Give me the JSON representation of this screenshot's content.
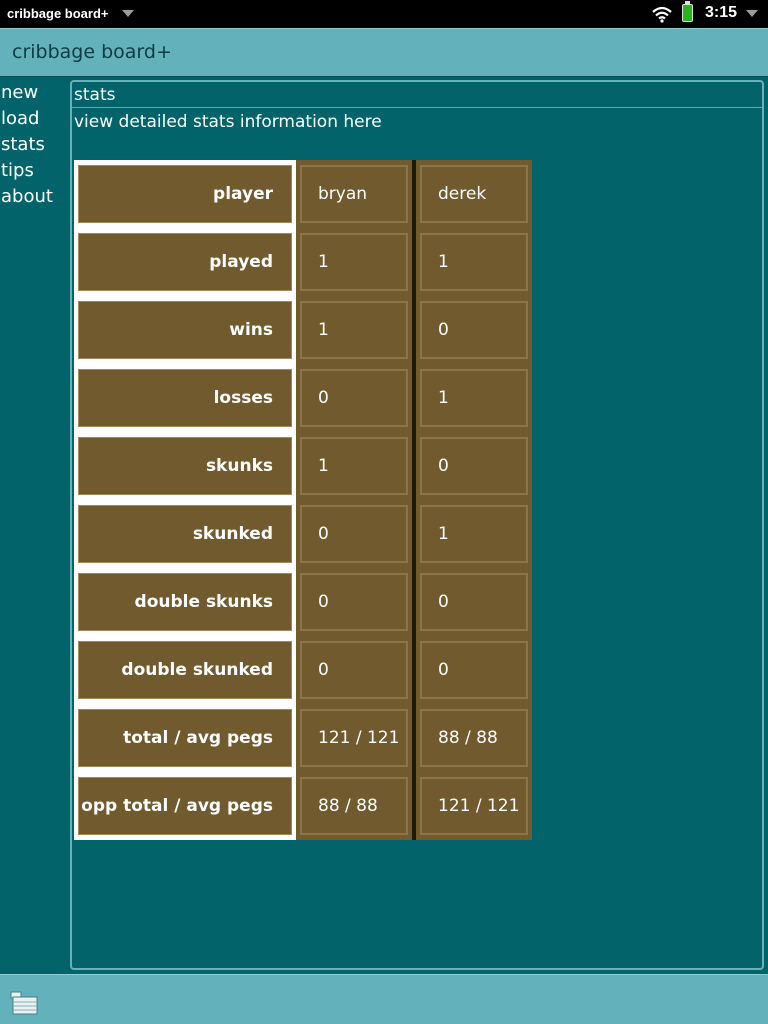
{
  "status_bar": {
    "app_name": "cribbage board+",
    "time": "3:15",
    "icons": [
      "chevron-down-icon",
      "wifi-icon",
      "battery-icon",
      "chevron-down-icon"
    ],
    "battery_color": "#29b41e"
  },
  "header": {
    "title": "cribbage board+"
  },
  "sidenav": {
    "items": [
      {
        "label": "new"
      },
      {
        "label": "load"
      },
      {
        "label": "stats"
      },
      {
        "label": "tips"
      },
      {
        "label": "about"
      }
    ]
  },
  "main": {
    "title": "stats",
    "description": "view detailed stats information here",
    "table": {
      "rows": [
        {
          "label": "player",
          "a": "bryan",
          "b": "derek"
        },
        {
          "label": "played",
          "a": "1",
          "b": "1"
        },
        {
          "label": "wins",
          "a": "1",
          "b": "0"
        },
        {
          "label": "losses",
          "a": "0",
          "b": "1"
        },
        {
          "label": "skunks",
          "a": "1",
          "b": "0"
        },
        {
          "label": "skunked",
          "a": "0",
          "b": "1"
        },
        {
          "label": "double skunks",
          "a": "0",
          "b": "0"
        },
        {
          "label": "double skunked",
          "a": "0",
          "b": "0"
        },
        {
          "label": "total / avg pegs",
          "a": "121 / 121",
          "b": "88 / 88"
        },
        {
          "label": "opp total / avg pegs",
          "a": "88 / 88",
          "b": "121 / 121"
        }
      ]
    }
  },
  "bottom_bar": {
    "icon": "app-menu-icon"
  },
  "colors": {
    "background": "#02636b",
    "header": "#63b1bb",
    "cell": "#705a2e",
    "label_border": "#ffffff"
  }
}
